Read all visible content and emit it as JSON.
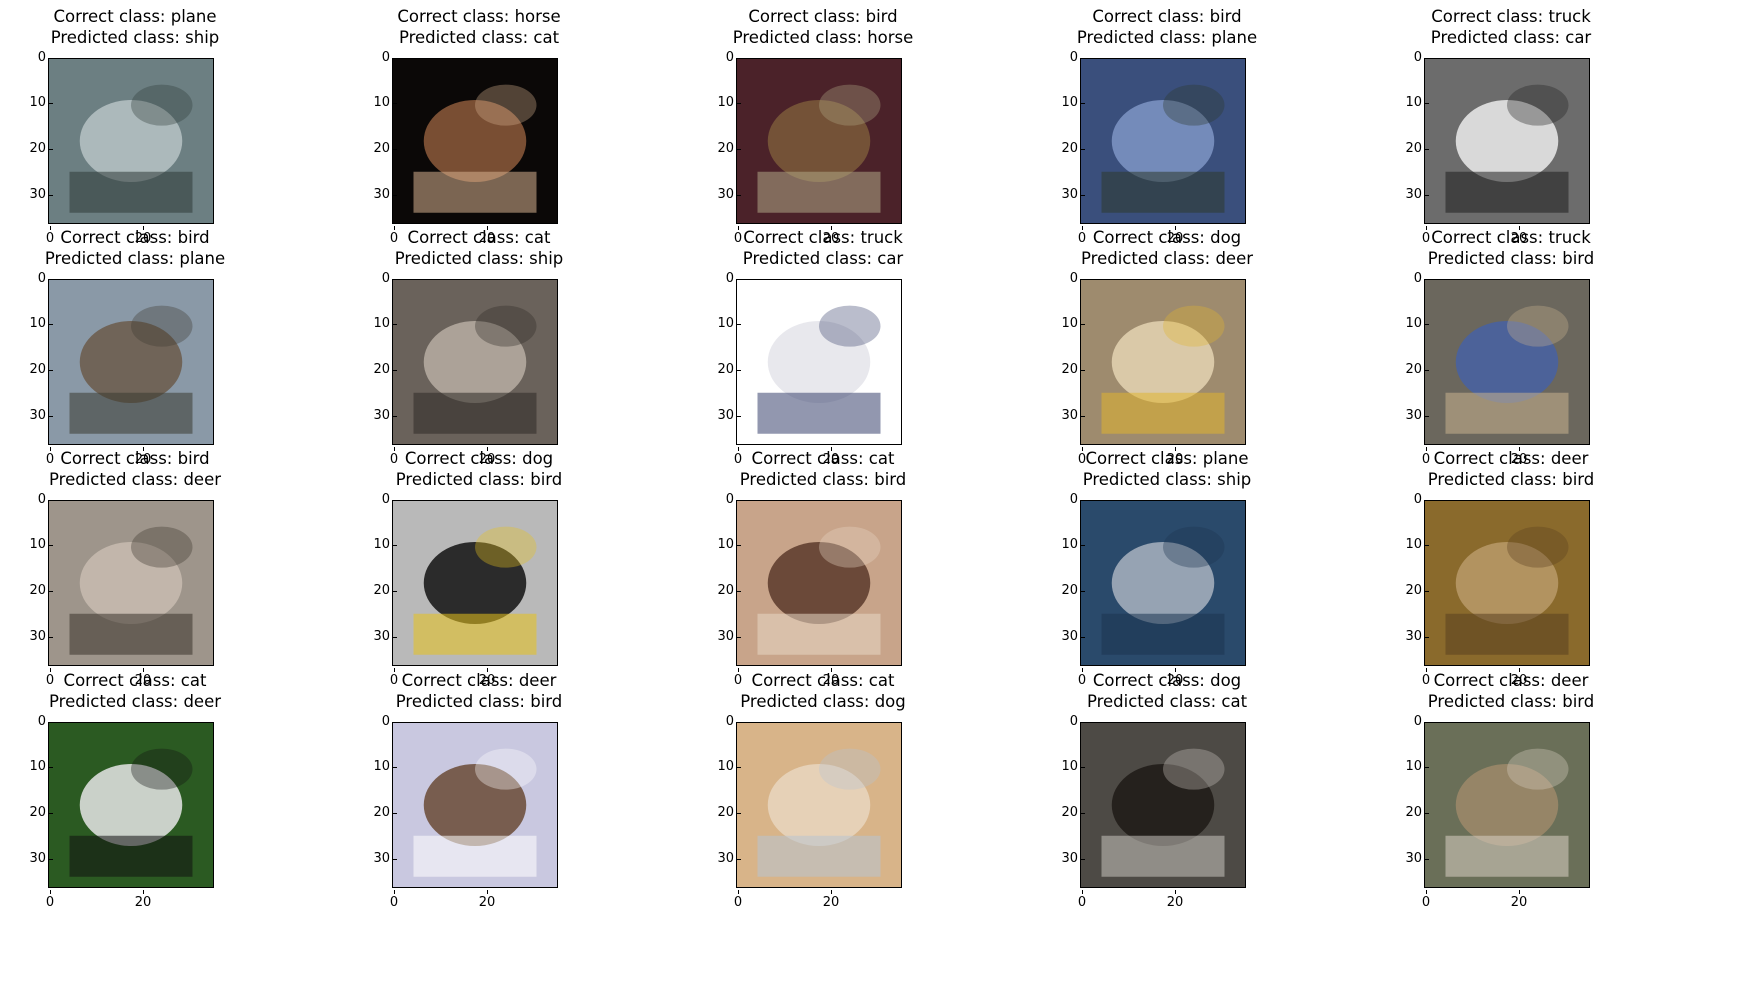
{
  "correct_prefix": "Correct class: ",
  "predicted_prefix": "Predicted class: ",
  "ticks": {
    "y": [
      "0",
      "10",
      "20",
      "30"
    ],
    "x": [
      "0",
      "20"
    ]
  },
  "panels": [
    {
      "correct": "plane",
      "predicted": "ship",
      "colors": [
        "#6c7f82",
        "#b7c3c6",
        "#2f3b38"
      ]
    },
    {
      "correct": "horse",
      "predicted": "cat",
      "colors": [
        "#0b0807",
        "#8d5a3b",
        "#d8b28f"
      ]
    },
    {
      "correct": "bird",
      "predicted": "horse",
      "colors": [
        "#4b2229",
        "#7b5a3a",
        "#b1a886"
      ]
    },
    {
      "correct": "bird",
      "predicted": "plane",
      "colors": [
        "#3a4f7c",
        "#7f95c6",
        "#2d3a2c"
      ]
    },
    {
      "correct": "truck",
      "predicted": "car",
      "colors": [
        "#6c6c6c",
        "#ececec",
        "#1f1f1f"
      ]
    },
    {
      "correct": "bird",
      "predicted": "plane",
      "colors": [
        "#8a99a7",
        "#6b5a4a",
        "#3b3a32"
      ]
    },
    {
      "correct": "cat",
      "predicted": "ship",
      "colors": [
        "#6a625b",
        "#b7aea3",
        "#2e2a26"
      ]
    },
    {
      "correct": "truck",
      "predicted": "car",
      "colors": [
        "#ffffff",
        "#e4e4ea",
        "#39416e"
      ]
    },
    {
      "correct": "dog",
      "predicted": "deer",
      "colors": [
        "#9e8b6e",
        "#e4d3b3",
        "#e0b530"
      ]
    },
    {
      "correct": "truck",
      "predicted": "bird",
      "colors": [
        "#6b675d",
        "#4661a3",
        "#c8b38e"
      ]
    },
    {
      "correct": "bird",
      "predicted": "deer",
      "colors": [
        "#9e958b",
        "#c8bcb0",
        "#3a332b"
      ]
    },
    {
      "correct": "dog",
      "predicted": "bird",
      "colors": [
        "#b9b9b9",
        "#121212",
        "#e7c21c"
      ]
    },
    {
      "correct": "cat",
      "predicted": "bird",
      "colors": [
        "#c8a48a",
        "#5a3a2a",
        "#e8d7c4"
      ]
    },
    {
      "correct": "plane",
      "predicted": "ship",
      "colors": [
        "#2a4a6b",
        "#a9b3bf",
        "#1c3550"
      ]
    },
    {
      "correct": "deer",
      "predicted": "bird",
      "colors": [
        "#8a6a2c",
        "#b99a6a",
        "#5a4020"
      ]
    },
    {
      "correct": "cat",
      "predicted": "deer",
      "colors": [
        "#2b5a22",
        "#e6e6e6",
        "#111111"
      ]
    },
    {
      "correct": "deer",
      "predicted": "bird",
      "colors": [
        "#c9c8e0",
        "#6a4a35",
        "#ffffff"
      ]
    },
    {
      "correct": "cat",
      "predicted": "dog",
      "colors": [
        "#d8b489",
        "#e9d6c0",
        "#b8c4d2"
      ]
    },
    {
      "correct": "dog",
      "predicted": "cat",
      "colors": [
        "#4d4a45",
        "#1e1a16",
        "#c9c4bd"
      ]
    },
    {
      "correct": "deer",
      "predicted": "bird",
      "colors": [
        "#6a6f58",
        "#9e8a6a",
        "#d9d0c4"
      ]
    }
  ]
}
